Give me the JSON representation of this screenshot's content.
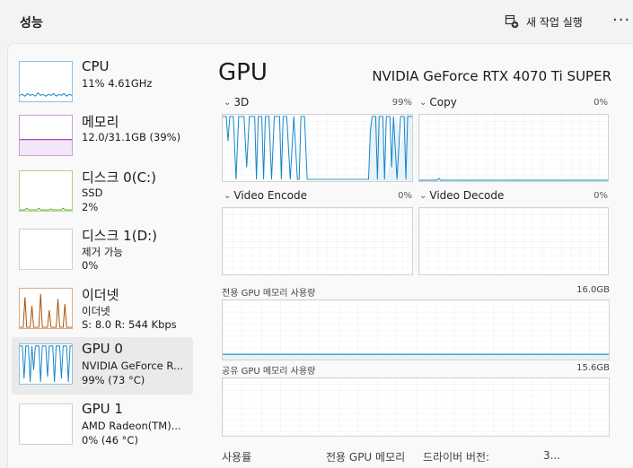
{
  "header": {
    "title": "성능",
    "new_task_label": "새 작업 실행",
    "more_label": "···"
  },
  "colors": {
    "cpu": "#117dbb",
    "memory": "#8b12ae",
    "disk": "#4da60c",
    "ethernet": "#a74f01",
    "gpu": "#1485c7"
  },
  "sidebar": {
    "items": [
      {
        "name": "CPU",
        "sub1": "11% 4.61GHz",
        "sub2": "",
        "icon": "cpu-graph"
      },
      {
        "name": "메모리",
        "sub1": "12.0/31.1GB (39%)",
        "sub2": "",
        "icon": "memory-graph"
      },
      {
        "name": "디스크 0(C:)",
        "sub1": "SSD",
        "sub2": "2%",
        "icon": "disk-graph"
      },
      {
        "name": "디스크 1(D:)",
        "sub1": "제거 가능",
        "sub2": "0%",
        "icon": "disk-graph"
      },
      {
        "name": "이더넷",
        "sub1": "이더넷",
        "sub2": "S: 8.0 R: 544 Kbps",
        "icon": "ethernet-graph"
      },
      {
        "name": "GPU 0",
        "sub1": "NVIDIA GeForce R...",
        "sub2": "99% (73 °C)",
        "icon": "gpu-graph"
      },
      {
        "name": "GPU 1",
        "sub1": "AMD Radeon(TM)...",
        "sub2": "0% (46 °C)",
        "icon": "gpu-graph"
      }
    ]
  },
  "main": {
    "title": "GPU",
    "model": "NVIDIA GeForce RTX 4070 Ti SUPER",
    "engines": [
      {
        "label": "3D",
        "percent": "99%"
      },
      {
        "label": "Copy",
        "percent": "0%"
      },
      {
        "label": "Video Encode",
        "percent": "0%"
      },
      {
        "label": "Video Decode",
        "percent": "0%"
      }
    ],
    "dedicated_memory": {
      "label": "전용 GPU 메모리 사용량",
      "value": "16.0GB"
    },
    "shared_memory": {
      "label": "공유 GPU 메모리 사용량",
      "value": "15.6GB"
    },
    "stats": {
      "utilization": "사용률",
      "dedicated": "전용 GPU 메모리",
      "driver_version": "드라이버 버전:",
      "driver_version_value": "3..."
    }
  }
}
